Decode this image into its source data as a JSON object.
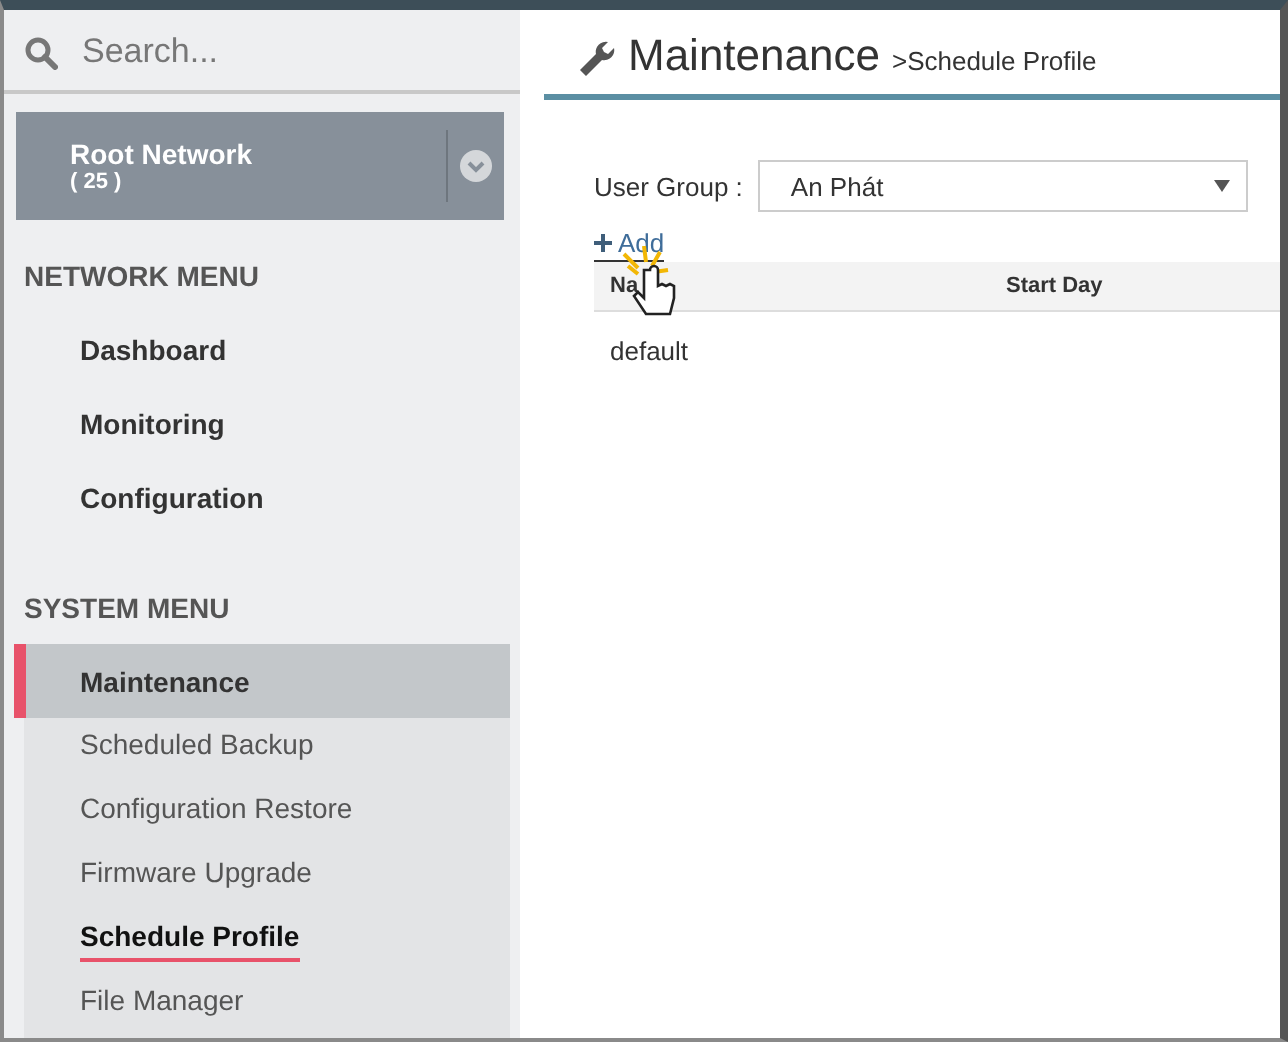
{
  "sidebar": {
    "search": {
      "placeholder": "Search..."
    },
    "network": {
      "name": "Root Network",
      "count": "( 25 )"
    },
    "sections": [
      {
        "title": "NETWORK MENU",
        "items": [
          {
            "label": "Dashboard",
            "selected": false
          },
          {
            "label": "Monitoring",
            "selected": false
          },
          {
            "label": "Configuration",
            "selected": false
          }
        ]
      },
      {
        "title": "SYSTEM MENU",
        "items": [
          {
            "label": "Maintenance",
            "selected": true,
            "children": [
              {
                "label": "Scheduled Backup",
                "selected": false
              },
              {
                "label": "Configuration Restore",
                "selected": false
              },
              {
                "label": "Firmware Upgrade",
                "selected": false
              },
              {
                "label": "Schedule Profile",
                "selected": true
              },
              {
                "label": "File Manager",
                "selected": false
              }
            ]
          }
        ]
      }
    ]
  },
  "main": {
    "title": "Maintenance",
    "breadcrumb": ">Schedule Profile",
    "user_group": {
      "label": "User Group :",
      "value": "An Phát"
    },
    "add": "Add",
    "table": {
      "columns": [
        "Na",
        "Start Day"
      ],
      "rows": [
        [
          "default",
          ""
        ]
      ]
    }
  }
}
